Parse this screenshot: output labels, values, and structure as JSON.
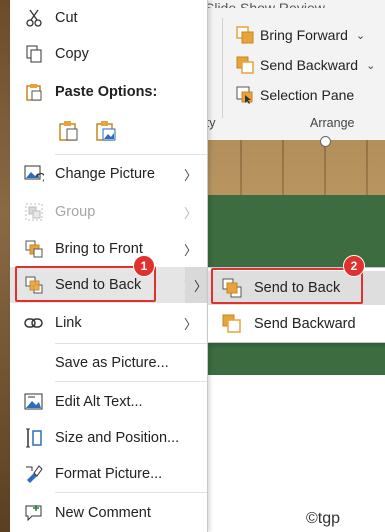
{
  "ribbon": {
    "top_partial": "Slide Show      Review",
    "bring_forward": "Bring Forward",
    "send_backward": "Send Backward",
    "selection_pane": "Selection Pane",
    "group_label": "Arrange",
    "left_group_label": "ity"
  },
  "menu": {
    "cut": "Cut",
    "copy": "Copy",
    "paste_options": "Paste Options:",
    "change_picture": "Change Picture",
    "group": "Group",
    "bring_to_front": "Bring to Front",
    "send_to_back": "Send to Back",
    "link": "Link",
    "save_as_picture": "Save as Picture...",
    "edit_alt_text": "Edit Alt Text...",
    "size_and_position": "Size and Position...",
    "format_picture": "Format Picture...",
    "new_comment": "New Comment"
  },
  "submenu": {
    "send_to_back": "Send to Back",
    "send_backward": "Send Backward"
  },
  "badges": {
    "first": "1",
    "second": "2"
  },
  "watermark": "©tgp",
  "colors": {
    "accent_red": "#e0312f",
    "icon_orange": "#e8a33d"
  }
}
